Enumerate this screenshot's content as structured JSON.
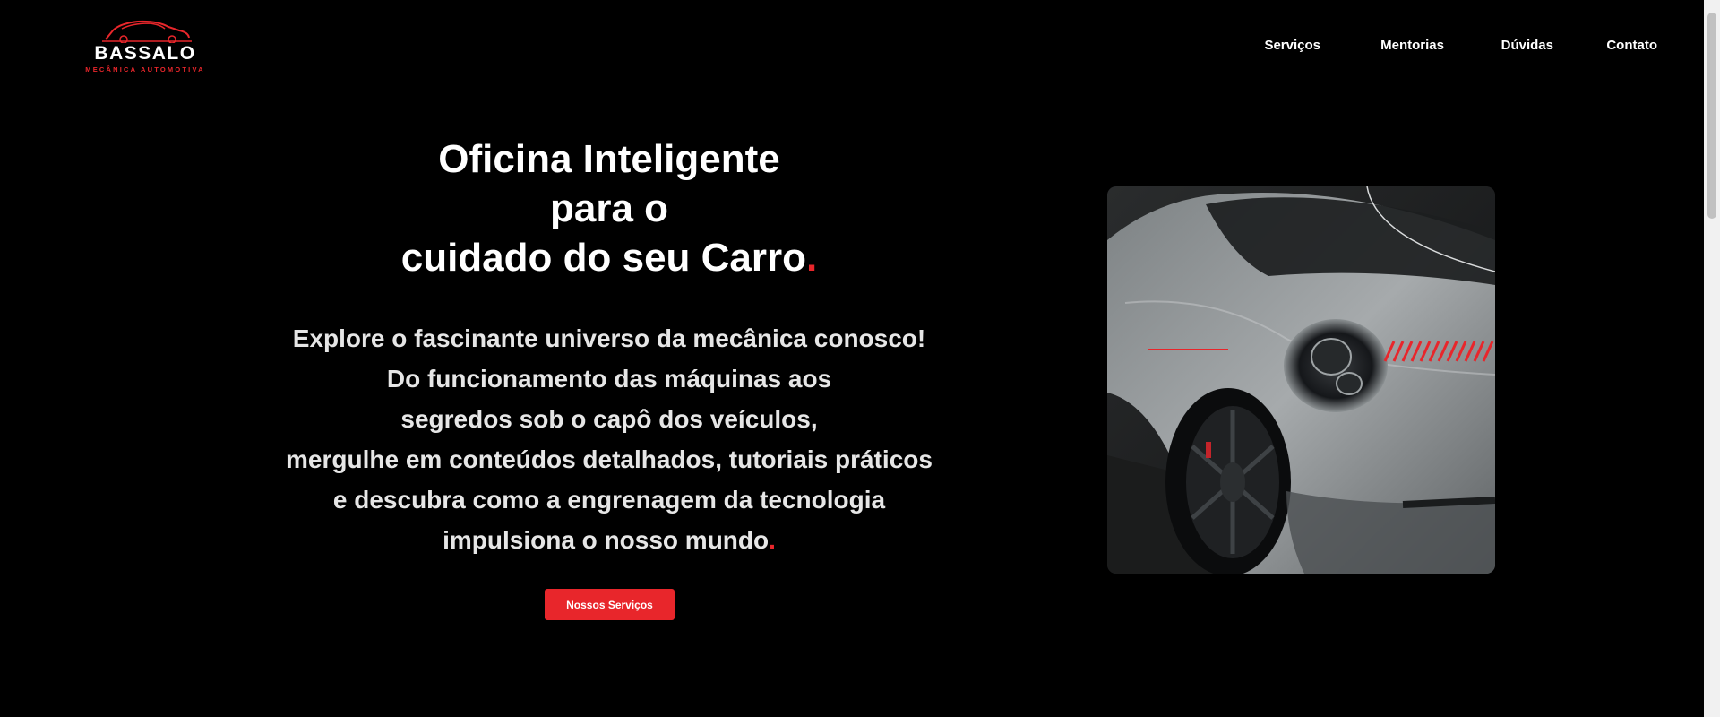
{
  "brand": {
    "name": "BASSALO",
    "tagline": "MECÂNICA AUTOMOTIVA",
    "logo_icon": "car-outline-icon",
    "accent_color": "#e8262b"
  },
  "nav": {
    "items": [
      {
        "label": "Serviços"
      },
      {
        "label": "Mentorias"
      },
      {
        "label": "Dúvidas"
      },
      {
        "label": "Contato"
      }
    ]
  },
  "hero": {
    "headline": {
      "line1": "Oficina Inteligente",
      "line2": "para o",
      "line3": "cuidado do seu Carro",
      "period": "."
    },
    "description": {
      "lines": [
        "Explore o fascinante universo da mecânica conosco!",
        "Do funcionamento das máquinas aos",
        "segredos sob o capô dos veículos,",
        "mergulhe em conteúdos detalhados, tutoriais práticos",
        "e descubra como a engrenagem da tecnologia",
        "impulsiona o nosso mundo"
      ],
      "period": "."
    },
    "cta_label": "Nossos Serviços",
    "image_subject": "grey sports car front view"
  }
}
